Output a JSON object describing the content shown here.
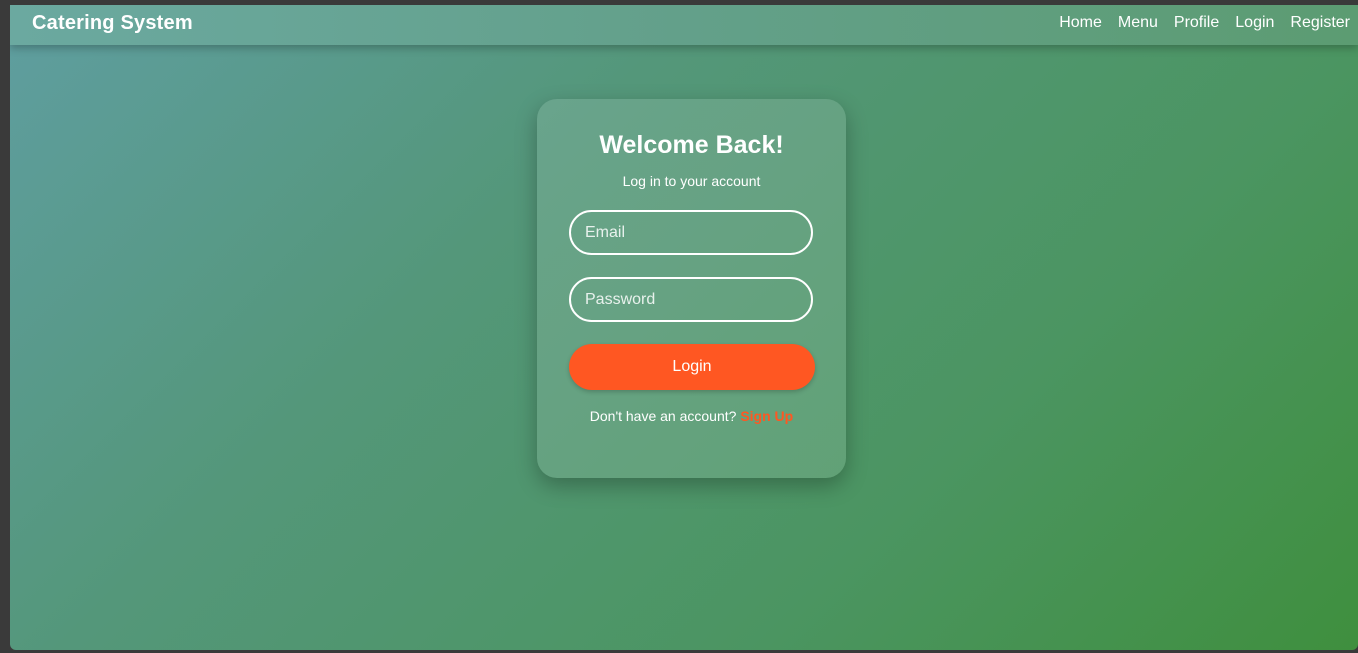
{
  "navbar": {
    "brand": "Catering System",
    "links": [
      {
        "label": "Home"
      },
      {
        "label": "Menu"
      },
      {
        "label": "Profile"
      },
      {
        "label": "Login"
      },
      {
        "label": "Register"
      }
    ]
  },
  "login_card": {
    "title": "Welcome Back!",
    "subtitle": "Log in to your account",
    "email": {
      "placeholder": "Email",
      "value": ""
    },
    "password": {
      "placeholder": "Password",
      "value": ""
    },
    "login_button": "Login",
    "signup_prompt": "Don't have an account?",
    "signup_link": "Sign Up"
  },
  "colors": {
    "accent": "#ff5722",
    "background_start": "#5f9ea0",
    "background_end": "#3f8f3e",
    "text": "#ffffff"
  }
}
